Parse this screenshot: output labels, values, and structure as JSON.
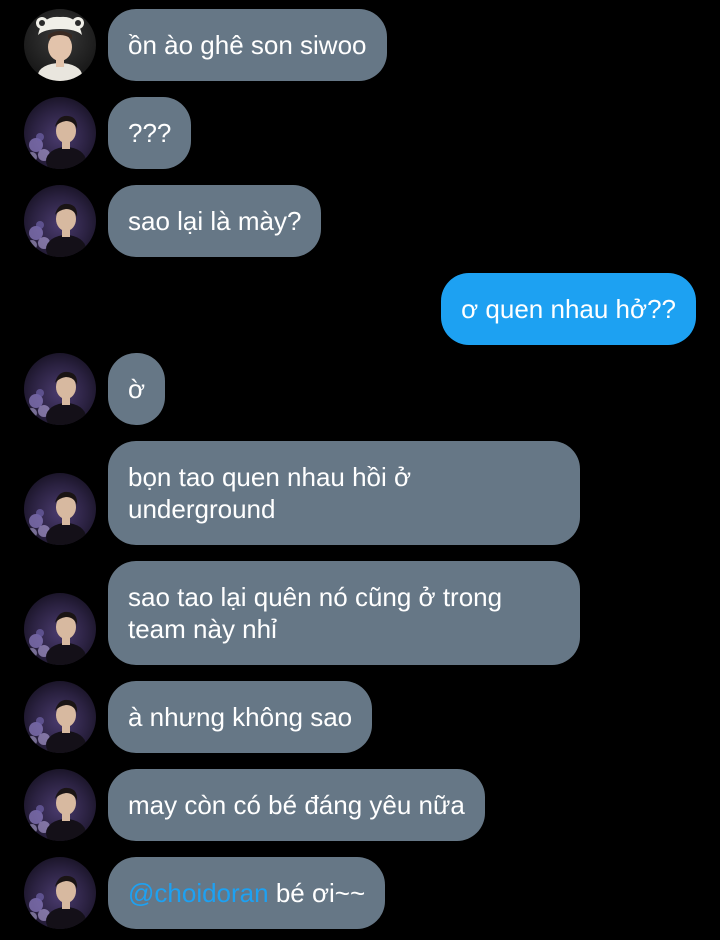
{
  "conversation": {
    "messages": [
      {
        "id": 0,
        "side": "in",
        "avatar": "avatar-a",
        "text": "ồn ào ghê son siwoo"
      },
      {
        "id": 1,
        "side": "in",
        "avatar": "avatar-b",
        "text": "???"
      },
      {
        "id": 2,
        "side": "in",
        "avatar": "avatar-b",
        "text": "sao lại là mày?"
      },
      {
        "id": 3,
        "side": "out",
        "text": "ơ quen nhau hở??"
      },
      {
        "id": 4,
        "side": "in",
        "avatar": "avatar-b",
        "text": "ờ"
      },
      {
        "id": 5,
        "side": "in",
        "avatar": "avatar-b",
        "text": "bọn tao quen nhau hồi ở underground"
      },
      {
        "id": 6,
        "side": "in",
        "avatar": "avatar-b",
        "text": "sao tao lại quên nó cũng ở trong team này nhỉ"
      },
      {
        "id": 7,
        "side": "in",
        "avatar": "avatar-b",
        "text": "à nhưng không sao"
      },
      {
        "id": 8,
        "side": "in",
        "avatar": "avatar-b",
        "text": "may còn có bé đáng yêu nữa"
      },
      {
        "id": 9,
        "side": "in",
        "avatar": "avatar-b",
        "mention": "@choidoran",
        "text": " bé ơi~~"
      }
    ]
  },
  "colors": {
    "background": "#000000",
    "incoming_bubble": "#667786",
    "outgoing_bubble": "#1da1f2",
    "mention": "#1da1f2",
    "text": "#ffffff"
  }
}
